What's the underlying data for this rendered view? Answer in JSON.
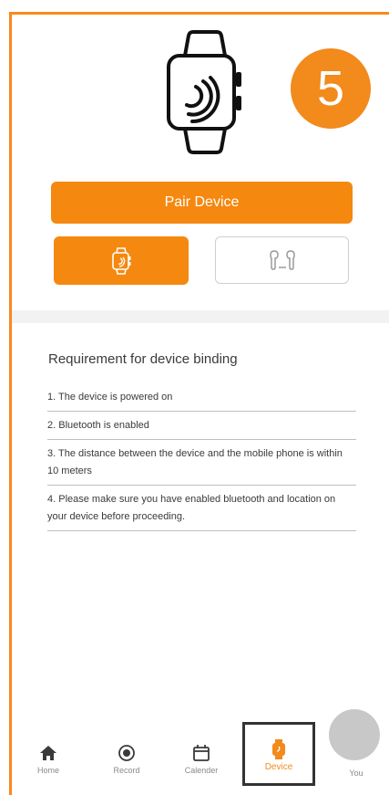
{
  "colors": {
    "accent": "#f5880f",
    "frame": "#f68a1e",
    "text": "#3a3a3a",
    "muted": "#8a8a8a",
    "divider": "#bfbfbf",
    "avatar": "#c8c8c8"
  },
  "header": {
    "step_badge": "5",
    "illustration_icon": "smartwatch-icon"
  },
  "pair_button": {
    "label": "Pair Device"
  },
  "device_types": [
    {
      "icon": "smartwatch-icon",
      "selected": true
    },
    {
      "icon": "earbuds-icon",
      "selected": false
    }
  ],
  "requirements": {
    "title": "Requirement for device binding",
    "items": [
      "1. The device is powered on",
      "2. Bluetooth is enabled",
      "3. The distance between the device and the mobile phone is within 10 meters",
      "4. Please make sure you have enabled bluetooth and location on your device before proceeding."
    ]
  },
  "tabbar": {
    "items": [
      {
        "label": "Home",
        "icon": "home-icon"
      },
      {
        "label": "Record",
        "icon": "record-icon"
      },
      {
        "label": "Calender",
        "icon": "calendar-icon"
      },
      {
        "label": "Device",
        "icon": "device-watch-icon",
        "active": true
      },
      {
        "label": "You",
        "icon": "avatar"
      }
    ]
  }
}
